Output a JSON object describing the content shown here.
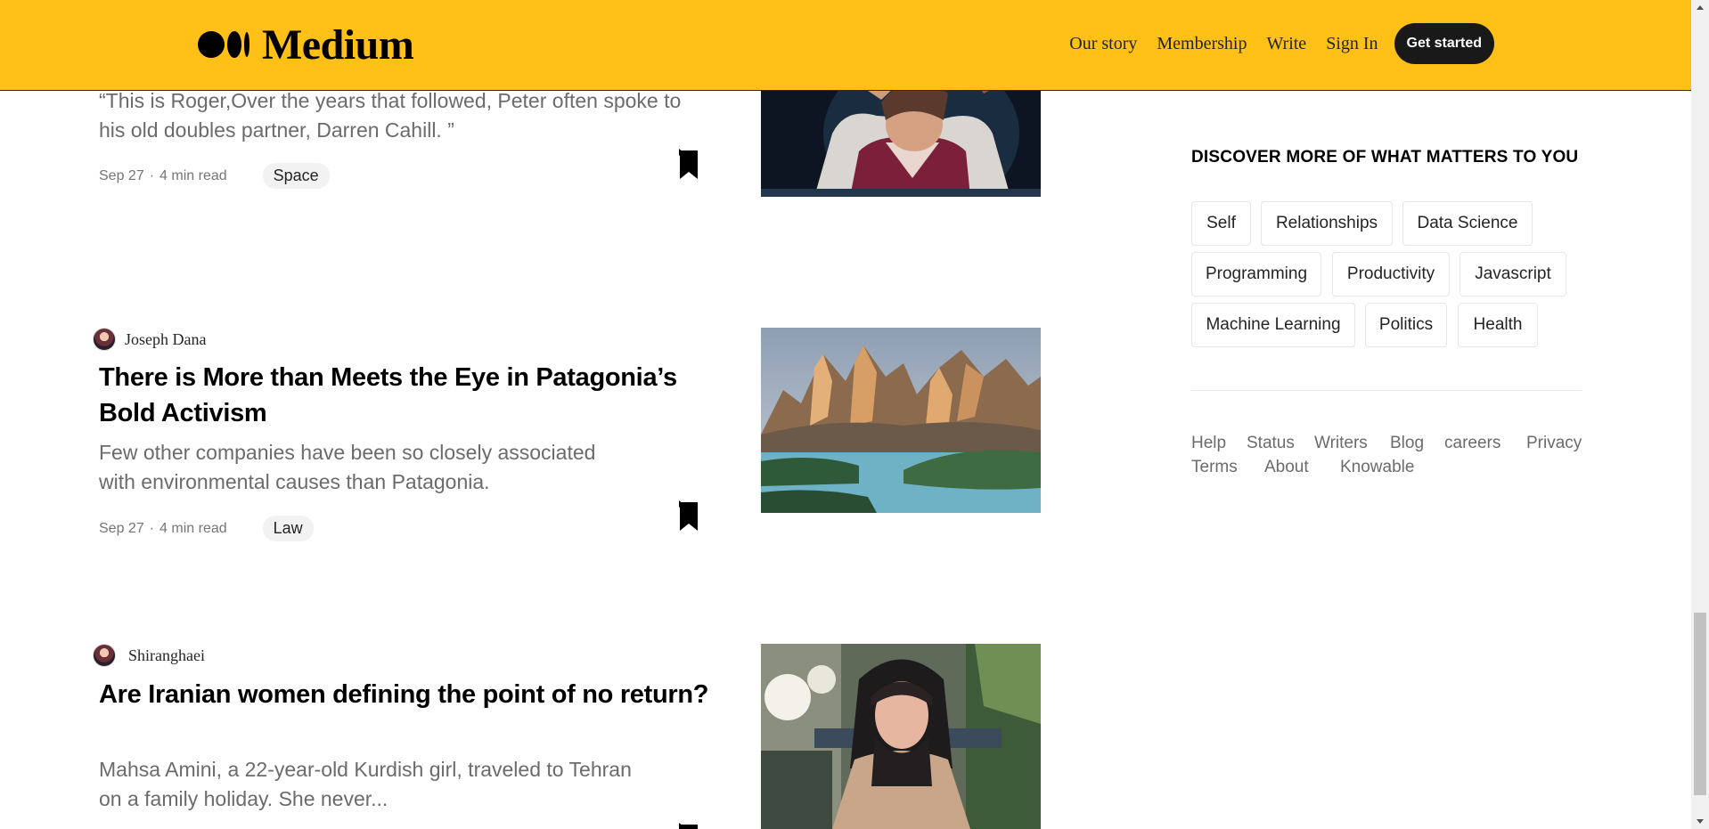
{
  "header": {
    "logo_text": "Medium",
    "nav": [
      "Our story",
      "Membership",
      "Write",
      "Sign In"
    ],
    "cta": "Get started"
  },
  "posts": [
    {
      "subtitle": "“This is Roger,Over the years that followed, Peter often spoke to his old doubles partner, Darren Cahill. ”",
      "date": "Sep 27",
      "read_time": "4 min read",
      "tag": "Space"
    },
    {
      "author": "Joseph Dana",
      "title": "There is More than Meets the Eye in Patagonia’s Bold Activism",
      "subtitle": "Few other companies have been so closely associated with environmental causes than Patagonia.",
      "date": "Sep 27",
      "read_time": "4 min read",
      "tag": "Law"
    },
    {
      "author": "Shiranghaei",
      "title": "Are Iranian women defining the point of no return?",
      "subtitle": "Mahsa Amini, a 22-year-old Kurdish girl, traveled to Tehran on a family holiday. She never..."
    }
  ],
  "meta_separator": "·",
  "sidebar": {
    "discover_title": "DISCOVER MORE OF WHAT MATTERS TO YOU",
    "topics": [
      "Self",
      "Relationships",
      "Data Science",
      "Programming",
      "Productivity",
      "Javascript",
      "Machine Learning",
      "Politics",
      "Health"
    ],
    "footer_links": [
      "Help",
      "Status",
      "Writers",
      "Blog",
      "careers",
      "Privacy",
      "Terms",
      "About",
      "Knowable"
    ]
  },
  "colors": {
    "header_bg": "#ffc017",
    "button_bg": "#191919",
    "muted_text": "#6b6b6b"
  },
  "icons": {
    "bookmark": "bookmark-icon",
    "scroll_up": "chevron-up-icon",
    "scroll_down": "chevron-down-icon"
  }
}
